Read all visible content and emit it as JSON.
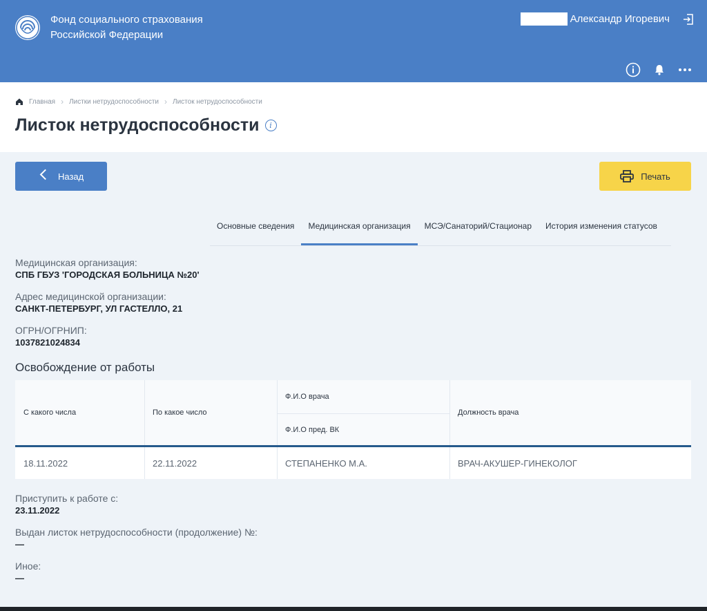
{
  "header": {
    "org_line1": "Фонд социального страхования",
    "org_line2": "Российской Федерации",
    "user_name": "Александр Игоревич",
    "icons": [
      "logo-icon",
      "logout-icon",
      "info-icon",
      "bell-icon",
      "more-icon"
    ]
  },
  "breadcrumb": {
    "items": [
      "Главная",
      "Листки нетрудоспособности",
      "Листок нетрудоспособности"
    ]
  },
  "page": {
    "title": "Листок нетрудоспособности"
  },
  "actions": {
    "back_label": "Назад",
    "print_label": "Печать"
  },
  "tabs": [
    {
      "label": "Основные сведения",
      "active": false
    },
    {
      "label": "Медицинская организация",
      "active": true
    },
    {
      "label": "МСЭ/Санаторий/Стационар",
      "active": false
    },
    {
      "label": "История изменения статусов",
      "active": false
    }
  ],
  "org": {
    "name_label": "Медицинская организация:",
    "name_value": "СПБ ГБУЗ 'ГОРОДСКАЯ БОЛЬНИЦА №20'",
    "address_label": "Адрес медицинской организации:",
    "address_value": "САНКТ-ПЕТЕРБУРГ, УЛ ГАСТЕЛЛО, 21",
    "ogrn_label": "ОГРН/ОГРНИП:",
    "ogrn_value": "1037821024834"
  },
  "release": {
    "title": "Освобождение от работы",
    "columns": {
      "from": "С какого числа",
      "to": "По какое число",
      "doctor": "Ф.И.О врача",
      "vk": "Ф.И.О пред. ВК",
      "position": "Должность врача"
    },
    "rows": [
      {
        "from": "18.11.2022",
        "to": "22.11.2022",
        "doctor": "СТЕПАНЕНКО М.А.",
        "position": "ВРАЧ-АКУШЕР-ГИНЕКОЛОГ"
      }
    ]
  },
  "extra": {
    "return_label": "Приступить к работе с:",
    "return_value": "23.11.2022",
    "continuation_label": "Выдан листок нетрудоспособности (продолжение) №:",
    "continuation_value": "—",
    "other_label": "Иное:",
    "other_value": "—"
  },
  "colors": {
    "header_bg": "#4a7fc6",
    "primary": "#4a7fc6",
    "print_button": "#f7d449",
    "table_divider": "#265a8c"
  }
}
